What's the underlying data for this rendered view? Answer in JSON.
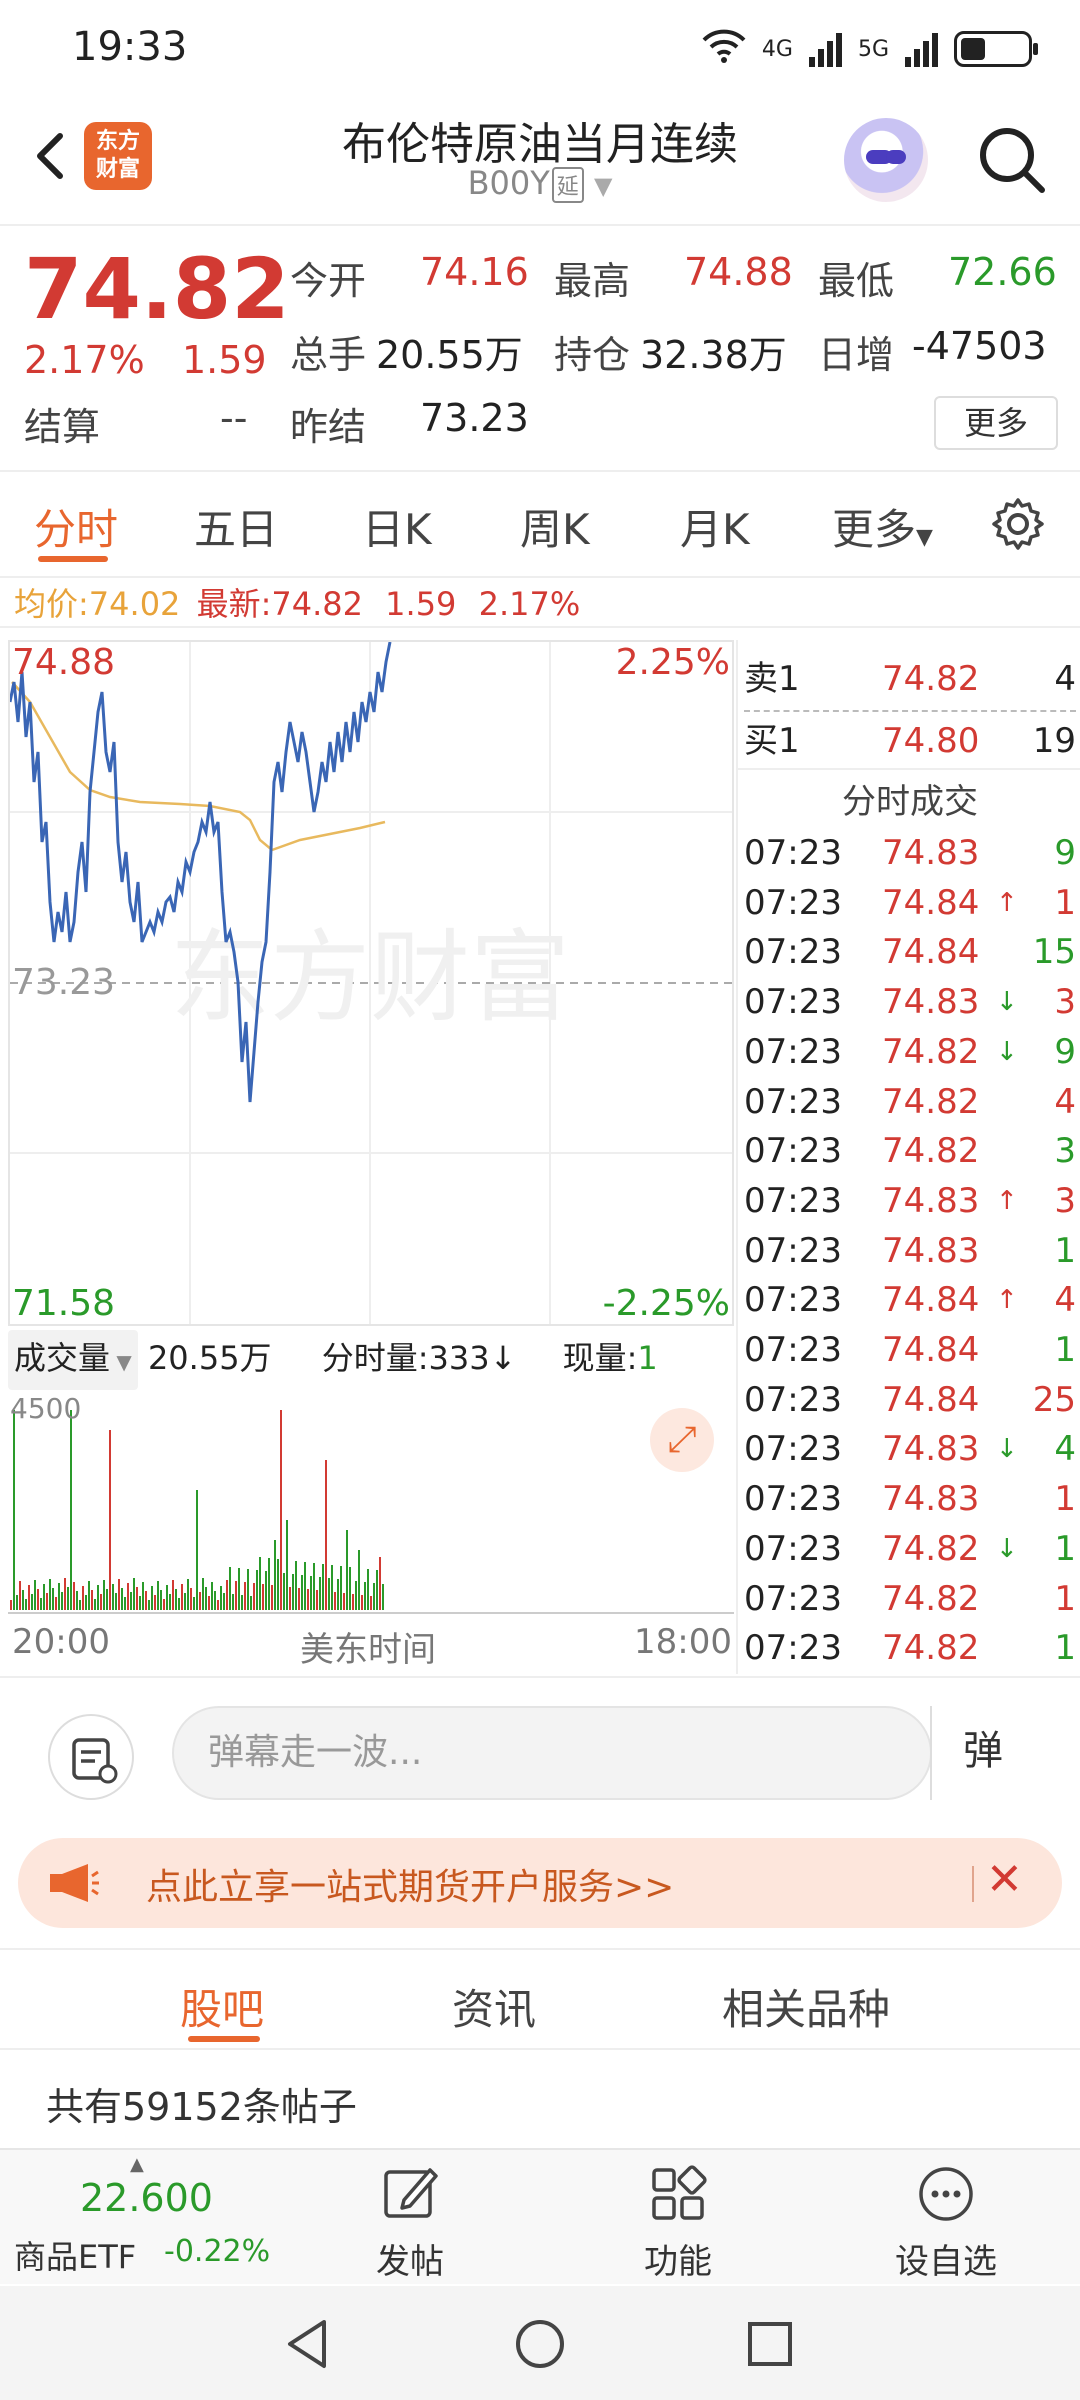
{
  "status": {
    "time": "19:33",
    "net1": "4G",
    "net2": "5G"
  },
  "header": {
    "title": "布伦特原油当月连续",
    "code": "B00Y",
    "tag": "延",
    "logo_line1": "东方",
    "logo_line2": "财富"
  },
  "quote": {
    "price": "74.82",
    "pct": "2.17%",
    "change": "1.59",
    "open_label": "今开",
    "open": "74.16",
    "high_label": "最高",
    "high": "74.88",
    "low_label": "最低",
    "low": "72.66",
    "vol_label": "总手",
    "vol": "20.55万",
    "oi_label": "持仓",
    "oi": "32.38万",
    "daily_label": "日增",
    "daily": "-47503",
    "settle_label": "结算",
    "settle": "--",
    "prev_label": "昨结",
    "prev": "73.23",
    "more": "更多"
  },
  "tabs": [
    "分时",
    "五日",
    "日K",
    "周K",
    "月K",
    "更多"
  ],
  "info": {
    "avg_label": "均价:",
    "avg": "74.02",
    "latest_label": "最新:",
    "latest": "74.82",
    "change": "1.59",
    "pct": "2.17%"
  },
  "chart": {
    "max": "74.88",
    "min": "71.58",
    "ref": "73.23",
    "max_pct": "2.25%",
    "min_pct": "-2.25%",
    "watermark": "东方财富"
  },
  "volume": {
    "label": "成交量",
    "total": "20.55万",
    "minute_label": "分时量:333",
    "minute_arrow": "↓",
    "now_label": "现量:",
    "now": "1",
    "axis_max": "4500"
  },
  "time_axis": {
    "start": "20:00",
    "mid": "美东时间",
    "end": "18:00"
  },
  "orderbook": {
    "sell_label": "卖1",
    "sell_price": "74.82",
    "sell_vol": "4",
    "buy_label": "买1",
    "buy_price": "74.80",
    "buy_vol": "19",
    "trades_title": "分时成交"
  },
  "trades": [
    {
      "t": "07:23",
      "p": "74.83",
      "v": "9",
      "a": ""
    },
    {
      "t": "07:23",
      "p": "74.84",
      "v": "1",
      "a": "↑"
    },
    {
      "t": "07:23",
      "p": "74.84",
      "v": "15",
      "a": ""
    },
    {
      "t": "07:23",
      "p": "74.83",
      "v": "3",
      "a": "↓"
    },
    {
      "t": "07:23",
      "p": "74.82",
      "v": "9",
      "a": "↓"
    },
    {
      "t": "07:23",
      "p": "74.82",
      "v": "4",
      "a": ""
    },
    {
      "t": "07:23",
      "p": "74.82",
      "v": "3",
      "a": ""
    },
    {
      "t": "07:23",
      "p": "74.83",
      "v": "3",
      "a": "↑"
    },
    {
      "t": "07:23",
      "p": "74.83",
      "v": "1",
      "a": ""
    },
    {
      "t": "07:23",
      "p": "74.84",
      "v": "4",
      "a": "↑"
    },
    {
      "t": "07:23",
      "p": "74.84",
      "v": "1",
      "a": ""
    },
    {
      "t": "07:23",
      "p": "74.84",
      "v": "25",
      "a": ""
    },
    {
      "t": "07:23",
      "p": "74.83",
      "v": "4",
      "a": "↓"
    },
    {
      "t": "07:23",
      "p": "74.83",
      "v": "1",
      "a": ""
    },
    {
      "t": "07:23",
      "p": "74.82",
      "v": "1",
      "a": "↓"
    },
    {
      "t": "07:23",
      "p": "74.82",
      "v": "1",
      "a": ""
    },
    {
      "t": "07:23",
      "p": "74.82",
      "v": "1",
      "a": ""
    }
  ],
  "danmu": {
    "placeholder": "弹幕走一波...",
    "button": "弹"
  },
  "banner": {
    "text": "点此立享一站式期货开户服务>>"
  },
  "subtabs": [
    "股吧",
    "资讯",
    "相关品种"
  ],
  "posts": {
    "count_text": "共有59152条帖子"
  },
  "bottom": {
    "etf_price": "22.600",
    "etf_name": "商品ETF",
    "etf_pct": "-0.22%",
    "post": "发帖",
    "func": "功能",
    "watch": "设自选"
  },
  "colors": {
    "up": "#d23a33",
    "down": "#2a9a2a",
    "accent": "#e8662e",
    "line": "#3a66b5",
    "avg": "#e8b95e"
  }
}
